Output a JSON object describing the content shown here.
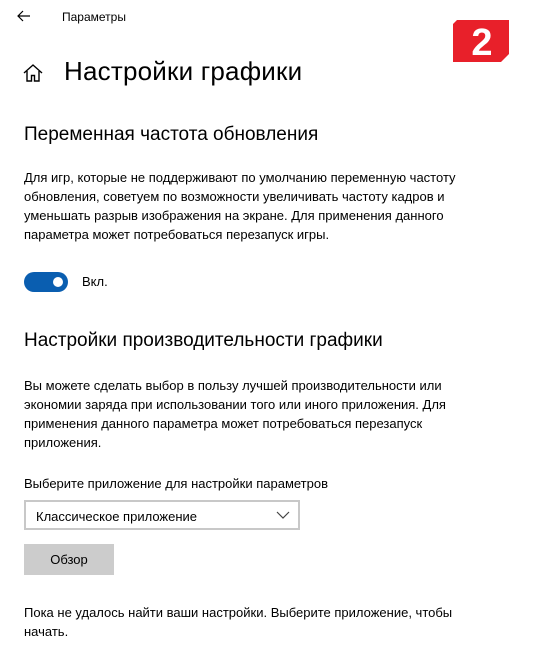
{
  "titlebar": {
    "app_title": "Параметры",
    "back_icon": "arrow-left-icon"
  },
  "badge": {
    "text": "2",
    "color": "#e8202a"
  },
  "header": {
    "home_icon": "home-icon",
    "title": "Настройки графики"
  },
  "vrr_section": {
    "heading": "Переменная частота обновления",
    "description": "Для игр, которые не поддерживают по умолчанию переменную частоту обновления, советуем по возможности увеличивать частоту кадров и уменьшать разрыв изображения на экране. Для применения данного параметра может потребоваться перезапуск игры.",
    "toggle_state": "on",
    "toggle_label": "Вкл.",
    "accent": "#0a5eb0"
  },
  "perf_section": {
    "heading": "Настройки производительности графики",
    "description": "Вы можете сделать выбор в пользу лучшей производительности или экономии заряда при использовании того или иного приложения. Для применения данного параметра может потребоваться перезапуск приложения.",
    "select_label": "Выберите приложение для настройки параметров",
    "select_value": "Классическое приложение",
    "browse_label": "Обзор",
    "status_text": "Пока не удалось найти ваши настройки. Выберите приложение, чтобы начать."
  }
}
